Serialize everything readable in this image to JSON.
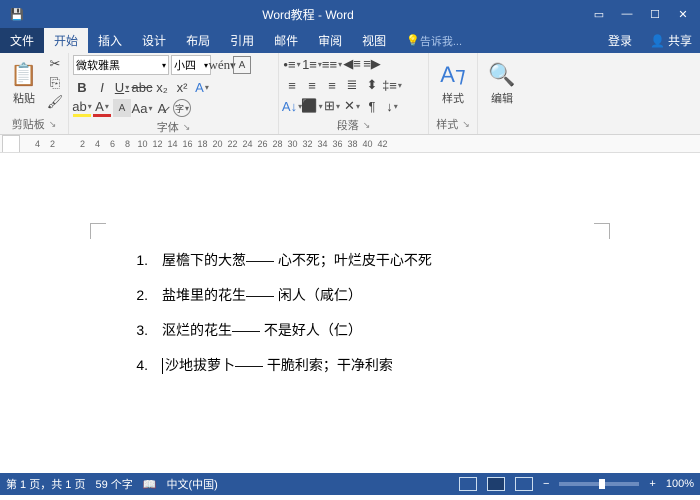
{
  "titlebar": {
    "title": "Word教程 - Word"
  },
  "tabs": {
    "file": "文件",
    "home": "开始",
    "insert": "插入",
    "design": "设计",
    "layout": "布局",
    "references": "引用",
    "mailings": "邮件",
    "review": "审阅",
    "view": "视图",
    "tell": "告诉我...",
    "login": "登录",
    "share": "共享"
  },
  "ribbon": {
    "clipboard": {
      "paste": "粘贴",
      "label": "剪贴板"
    },
    "font": {
      "family": "微软雅黑",
      "size": "小四",
      "label": "字体"
    },
    "paragraph": {
      "label": "段落"
    },
    "styles": {
      "btn": "样式",
      "label": "样式"
    },
    "editing": {
      "btn": "编辑"
    }
  },
  "ruler": {
    "marks": [
      "4",
      "2",
      "",
      "2",
      "4",
      "6",
      "8",
      "10",
      "12",
      "14",
      "16",
      "18",
      "20",
      "22",
      "24",
      "26",
      "28",
      "30",
      "32",
      "34",
      "36",
      "38",
      "40",
      "42"
    ]
  },
  "document": {
    "items": [
      {
        "n": "1.",
        "t": "屋檐下的大葱—— 心不死；叶烂皮干心不死"
      },
      {
        "n": "2.",
        "t": "盐堆里的花生—— 闲人（咸仁）"
      },
      {
        "n": "3.",
        "t": "沤烂的花生—— 不是好人（仁）"
      },
      {
        "n": "4.",
        "t": "沙地拔萝卜—— 干脆利索；干净利索"
      }
    ]
  },
  "status": {
    "page": "第 1 页，共 1 页",
    "words": "59 个字",
    "lang": "中文(中国)",
    "zoom": "100%"
  }
}
